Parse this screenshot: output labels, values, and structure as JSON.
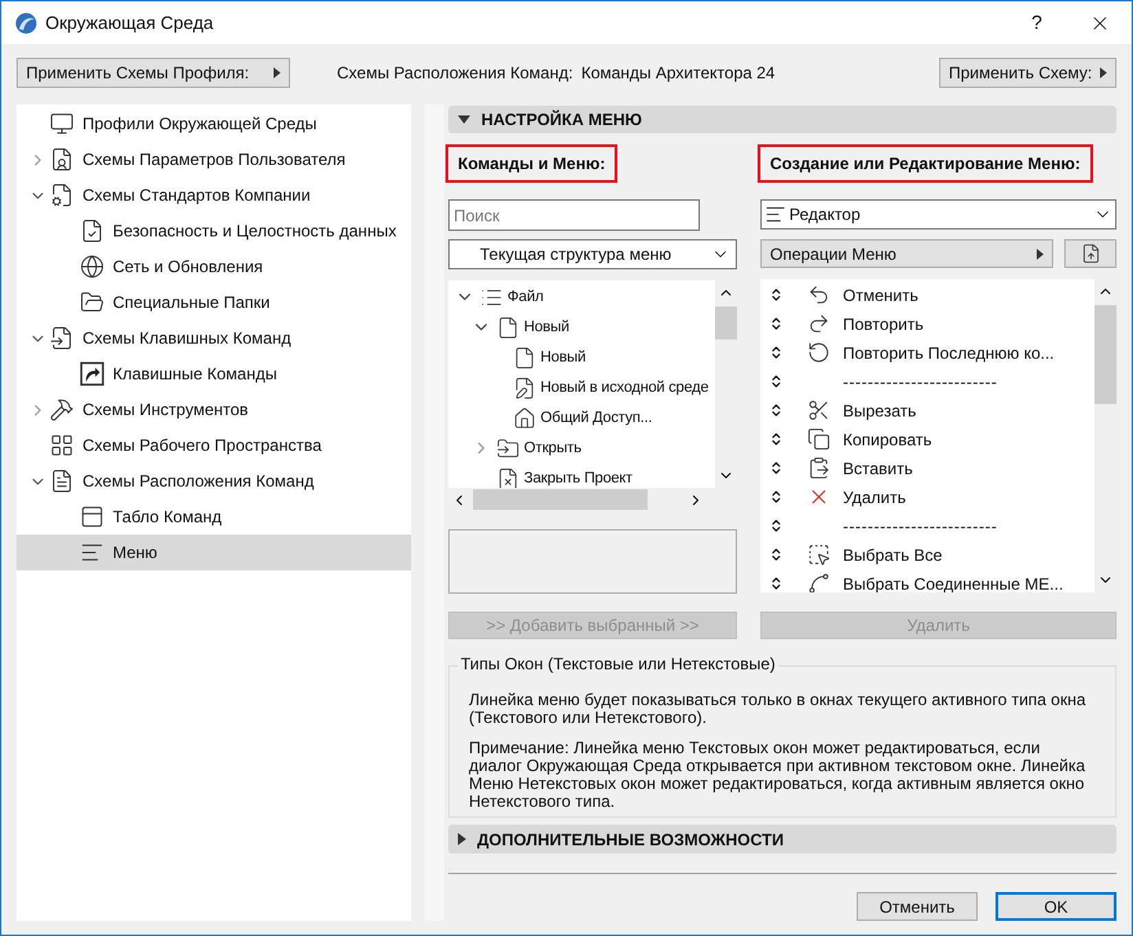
{
  "window": {
    "title": "Окружающая Среда",
    "help": "?"
  },
  "top_bar": {
    "profile_button": "Применить Схемы Профиля:",
    "scheme_label": "Схемы Расположения Команд:",
    "scheme_value": "Команды Архитектора 24",
    "apply_button": "Применить Схему:"
  },
  "sidebar": {
    "items": [
      {
        "label": "Профили Окружающей Среды",
        "selected": false
      },
      {
        "label": "Схемы Параметров Пользователя",
        "selected": false,
        "expanded": false
      },
      {
        "label": "Схемы Стандартов Компании",
        "selected": false,
        "expanded": true,
        "children": [
          {
            "label": "Безопасность и Целостность данных",
            "selected": false
          },
          {
            "label": "Сеть и Обновления",
            "selected": false
          },
          {
            "label": "Специальные Папки",
            "selected": false
          }
        ]
      },
      {
        "label": "Схемы Клавишных Команд",
        "selected": false,
        "expanded": true,
        "children": [
          {
            "label": "Клавишные Команды",
            "selected": false
          }
        ]
      },
      {
        "label": "Схемы Инструментов",
        "selected": false,
        "expanded": false
      },
      {
        "label": "Схемы Рабочего Пространства",
        "selected": false
      },
      {
        "label": "Схемы Расположения Команд",
        "selected": false,
        "expanded": true,
        "children": [
          {
            "label": "Табло Команд",
            "selected": false
          },
          {
            "label": "Меню",
            "selected": true
          }
        ]
      }
    ]
  },
  "menu_section": {
    "title": "НАСТРОЙКА МЕНЮ",
    "expanded": true
  },
  "commands": {
    "heading": "Команды и Меню:",
    "search": {
      "placeholder": "Поиск"
    },
    "structure_dropdown": "Текущая структура меню",
    "tree": [
      {
        "label": "Файл",
        "expanded": true,
        "children": [
          {
            "label": "Новый",
            "expanded": true,
            "children": [
              {
                "label": "Новый"
              },
              {
                "label": "Новый в исходной среде"
              },
              {
                "label": "Общий Доступ..."
              }
            ]
          },
          {
            "label": "Открыть",
            "expanded": false
          },
          {
            "label": "Закрыть Проект"
          }
        ]
      }
    ],
    "add_button": {
      "label": ">> Добавить выбранный >>",
      "disabled": true
    }
  },
  "editor": {
    "heading": "Создание или Редактирование Меню:",
    "menu_dropdown": "Редактор",
    "operations_button": "Операции Меню",
    "items": [
      {
        "kind": "command",
        "label": "Отменить"
      },
      {
        "kind": "command",
        "label": "Повторить"
      },
      {
        "kind": "command",
        "label": "Повторить Последнюю ко..."
      },
      {
        "kind": "separator",
        "label": "-------------------------"
      },
      {
        "kind": "command",
        "label": "Вырезать"
      },
      {
        "kind": "command",
        "label": "Копировать"
      },
      {
        "kind": "command",
        "label": "Вставить"
      },
      {
        "kind": "command",
        "label": "Удалить"
      },
      {
        "kind": "separator",
        "label": "-------------------------"
      },
      {
        "kind": "command",
        "label": "Выбрать Все"
      },
      {
        "kind": "command",
        "label": "Выбрать Соединенные МЕ..."
      }
    ],
    "delete_button": {
      "label": "Удалить",
      "disabled": true
    }
  },
  "window_types": {
    "title": "Типы Окон (Текстовые или Нетекстовые)",
    "paragraphs": [
      "Линейка меню будет показываться только в окнах текущего активного типа окна (Текстового или Нетекстового).",
      "Примечание: Линейка меню Текстовых окон может редактироваться, если диалог Окружающая Среда открывается при активном текстовом окне. Линейка Меню Нетекстовых окон может редактироваться, когда активным является окно Нетекстового типа."
    ]
  },
  "advanced_section": {
    "title": "ДОПОЛНИТЕЛЬНЫЕ ВОЗМОЖНОСТИ",
    "expanded": false
  },
  "buttons": {
    "cancel": "Отменить",
    "ok": "OK"
  }
}
